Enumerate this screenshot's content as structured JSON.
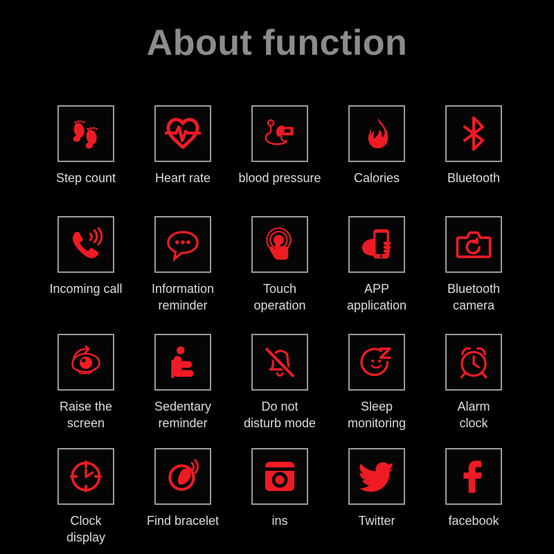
{
  "page": {
    "title": "About function",
    "background_color": "#000000",
    "title_color": "#8c8c8c",
    "icon_color": "#ef1b24",
    "box_border_color": "#9b9b9b",
    "label_color": "#dcdcdc"
  },
  "grid": {
    "columns": 5,
    "rows": 4,
    "items": [
      {
        "label": "Step count",
        "icon": "footprints-icon"
      },
      {
        "label": "Heart rate",
        "icon": "heart-pulse-icon"
      },
      {
        "label": "blood pressure",
        "icon": "blood-pressure-monitor-icon"
      },
      {
        "label": "Calories",
        "icon": "flame-icon"
      },
      {
        "label": "Bluetooth",
        "icon": "bluetooth-icon"
      },
      {
        "label": "Incoming call",
        "icon": "ringing-phone-icon"
      },
      {
        "label": "Information\nreminder",
        "icon": "speech-bubble-icon"
      },
      {
        "label": "Touch\noperation",
        "icon": "touch-tap-icon"
      },
      {
        "label": "APP\napplication",
        "icon": "hand-holding-phone-icon"
      },
      {
        "label": "Bluetooth\ncamera",
        "icon": "camera-icon"
      },
      {
        "label": "Raise the\nscreen",
        "icon": "raise-to-wake-eye-icon"
      },
      {
        "label": "Sedentary\nreminder",
        "icon": "seated-person-icon"
      },
      {
        "label": "Do not\ndisturb mode",
        "icon": "bell-muted-icon"
      },
      {
        "label": "Sleep\nmonitoring",
        "icon": "sleeping-face-z-icon"
      },
      {
        "label": "Alarm\nclock",
        "icon": "alarm-clock-icon"
      },
      {
        "label": "Clock\ndisplay",
        "icon": "clock-face-icon"
      },
      {
        "label": "Find bracelet",
        "icon": "find-bracelet-icon"
      },
      {
        "label": "ins",
        "icon": "instagram-icon"
      },
      {
        "label": "Twitter",
        "icon": "twitter-bird-icon"
      },
      {
        "label": "facebook",
        "icon": "facebook-f-icon"
      }
    ]
  }
}
